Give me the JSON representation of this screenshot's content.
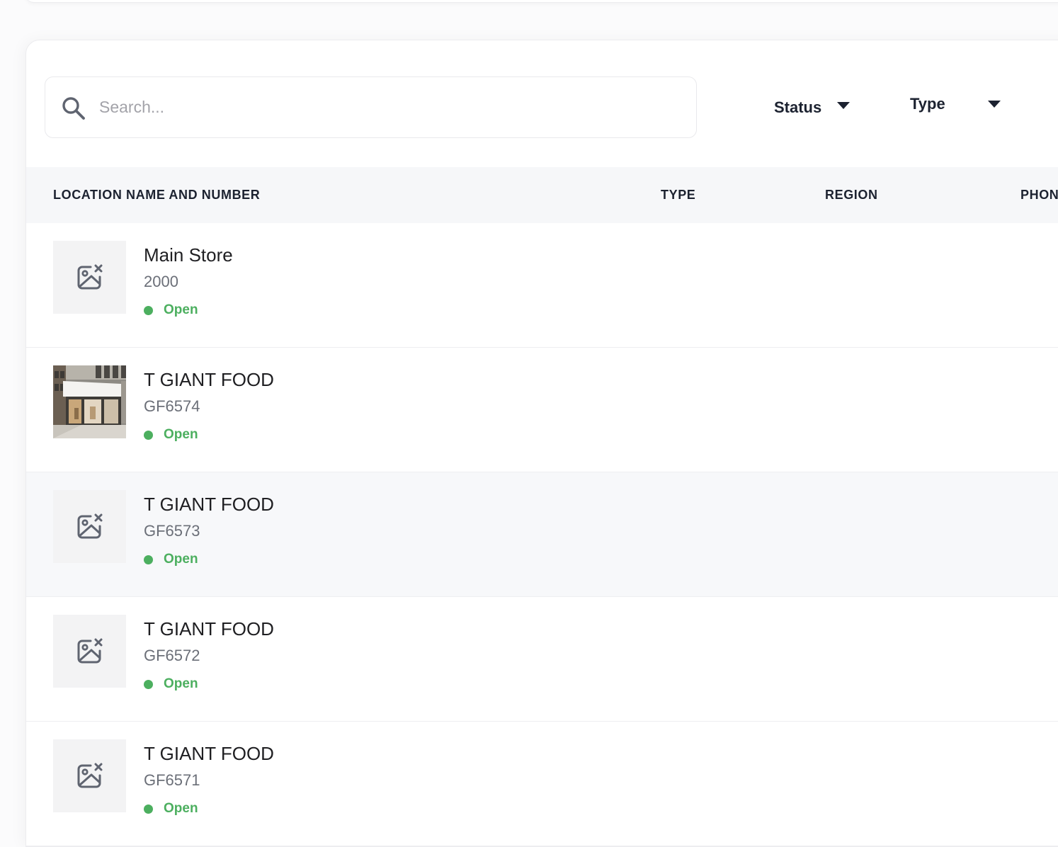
{
  "search": {
    "placeholder": "Search...",
    "value": ""
  },
  "filters": {
    "status_label": "Status",
    "type_label": "Type"
  },
  "table": {
    "columns": {
      "name": "LOCATION NAME AND NUMBER",
      "type": "TYPE",
      "region": "REGION",
      "phone": "PHON"
    },
    "rows": [
      {
        "name": "Main Store",
        "number": "2000",
        "status": "Open",
        "image": "no-image-icon"
      },
      {
        "name": "T GIANT FOOD",
        "number": "GF6574",
        "status": "Open",
        "image": "storefront-photo"
      },
      {
        "name": "T GIANT FOOD",
        "number": "GF6573",
        "status": "Open",
        "image": "no-image-icon"
      },
      {
        "name": "T GIANT FOOD",
        "number": "GF6572",
        "status": "Open",
        "image": "no-image-icon"
      },
      {
        "name": "T GIANT FOOD",
        "number": "GF6571",
        "status": "Open",
        "image": "no-image-icon"
      }
    ]
  },
  "colors": {
    "status_open": "#4caf5f",
    "header_bg": "#f6f7f9",
    "row_hover_bg": "#f7f8fa"
  }
}
